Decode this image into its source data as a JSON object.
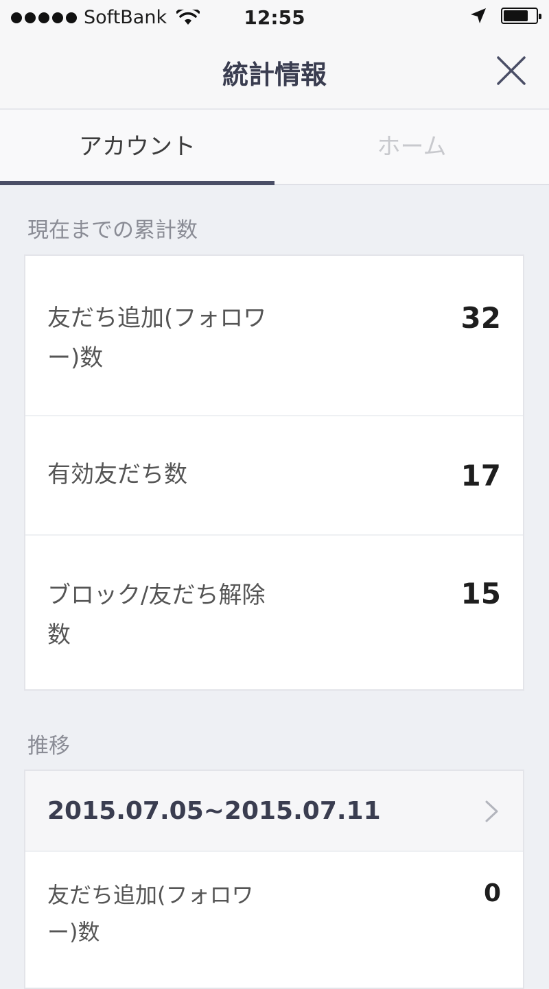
{
  "status": {
    "carrier": "SoftBank",
    "time": "12:55",
    "battery_level": 0.75
  },
  "header": {
    "title": "統計情報"
  },
  "tabs": [
    {
      "label": "アカウント",
      "active": true
    },
    {
      "label": "ホーム",
      "active": false
    }
  ],
  "cumulative": {
    "heading": "現在までの累計数",
    "rows": [
      {
        "label": "友だち追加(フォロワー)数",
        "value": "32"
      },
      {
        "label": "有効友だち数",
        "value": "17"
      },
      {
        "label": "ブロック/友だち解除数",
        "value": "15"
      }
    ]
  },
  "trend": {
    "heading": "推移",
    "range": "2015.07.05~2015.07.11",
    "rows": [
      {
        "label": "友だち追加(フォロワー)数",
        "value": "0"
      }
    ]
  },
  "icons": {
    "close": "close-icon",
    "chevron": "chevron-right-icon",
    "wifi": "wifi-icon",
    "location": "location-arrow-icon",
    "battery": "battery-icon"
  },
  "colors": {
    "accent": "#4a4e66",
    "background": "#eef0f4"
  }
}
